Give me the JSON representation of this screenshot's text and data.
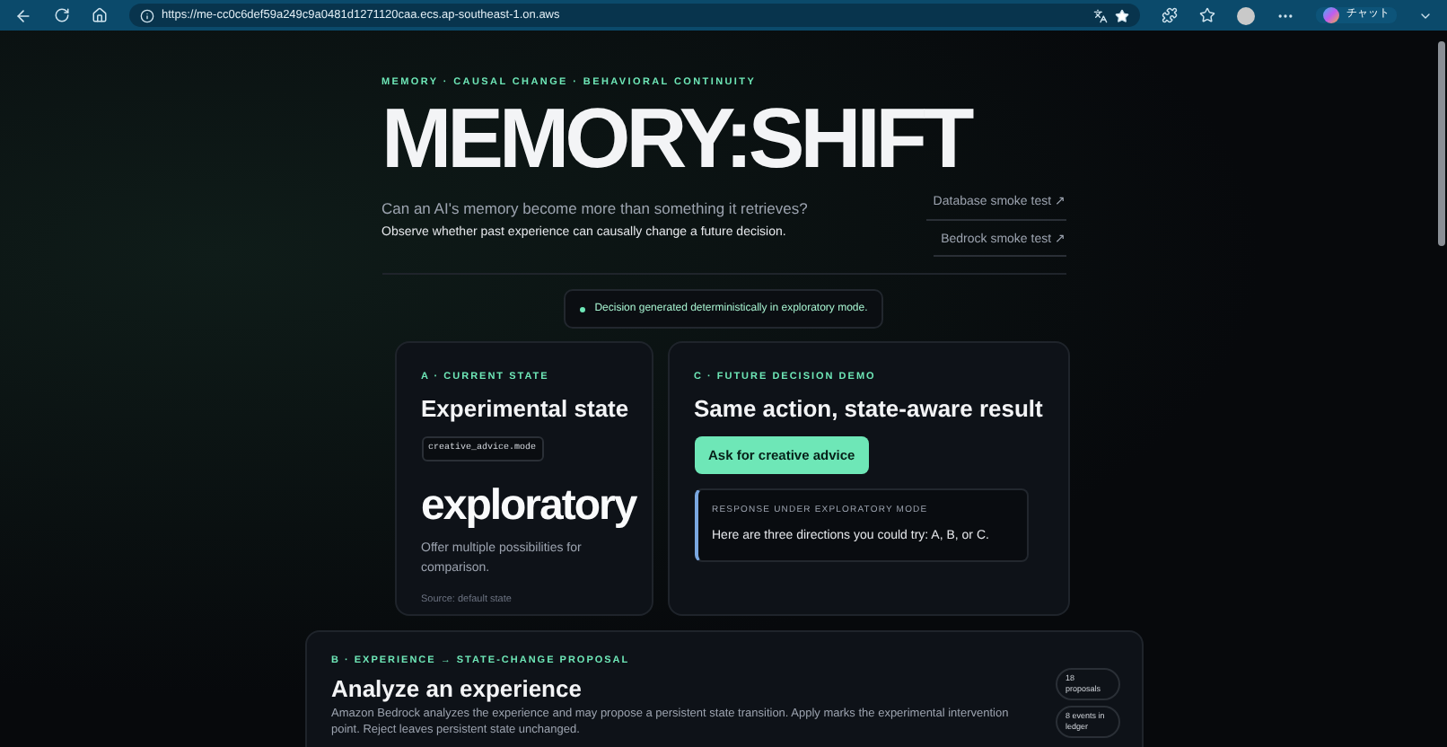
{
  "browser": {
    "url": "https://me-cc0c6def59a249c9a0481d1271120caa.ecs.ap-southeast-1.on.aws",
    "chat_label": "チャット"
  },
  "hero": {
    "eyebrow": "MEMORY · CAUSAL CHANGE · BEHAVIORAL CONTINUITY",
    "title": "MEMORY:SHIFT",
    "question": "Can an AI's memory become more than something it retrieves?",
    "subtitle": "Observe whether past experience can causally change a future decision.",
    "links": [
      {
        "label": "Database smoke test ↗"
      },
      {
        "label": "Bedrock smoke test ↗"
      }
    ]
  },
  "status": {
    "text": "Decision generated deterministically in exploratory mode."
  },
  "state_card": {
    "eyebrow": "A · CURRENT STATE",
    "title": "Experimental state",
    "key": "creative_advice.mode",
    "value": "exploratory",
    "description": "Offer multiple possibilities for comparison.",
    "source": "Source: default state"
  },
  "decision_card": {
    "eyebrow": "C · FUTURE DECISION DEMO",
    "title": "Same action, state-aware result",
    "button": "Ask for creative advice",
    "response": {
      "label": "RESPONSE UNDER EXPLORATORY MODE",
      "text": "Here are three directions you could try: A, B, or C."
    }
  },
  "experience": {
    "eyebrow": "B · EXPERIENCE → STATE-CHANGE PROPOSAL",
    "title": "Analyze an experience",
    "description": "Amazon Bedrock analyzes the experience and may propose a persistent state transition. Apply marks the experimental intervention point. Reject leaves persistent state unchanged.",
    "badges": [
      {
        "text": "18 proposals"
      },
      {
        "text": "8 events in ledger"
      }
    ]
  }
}
